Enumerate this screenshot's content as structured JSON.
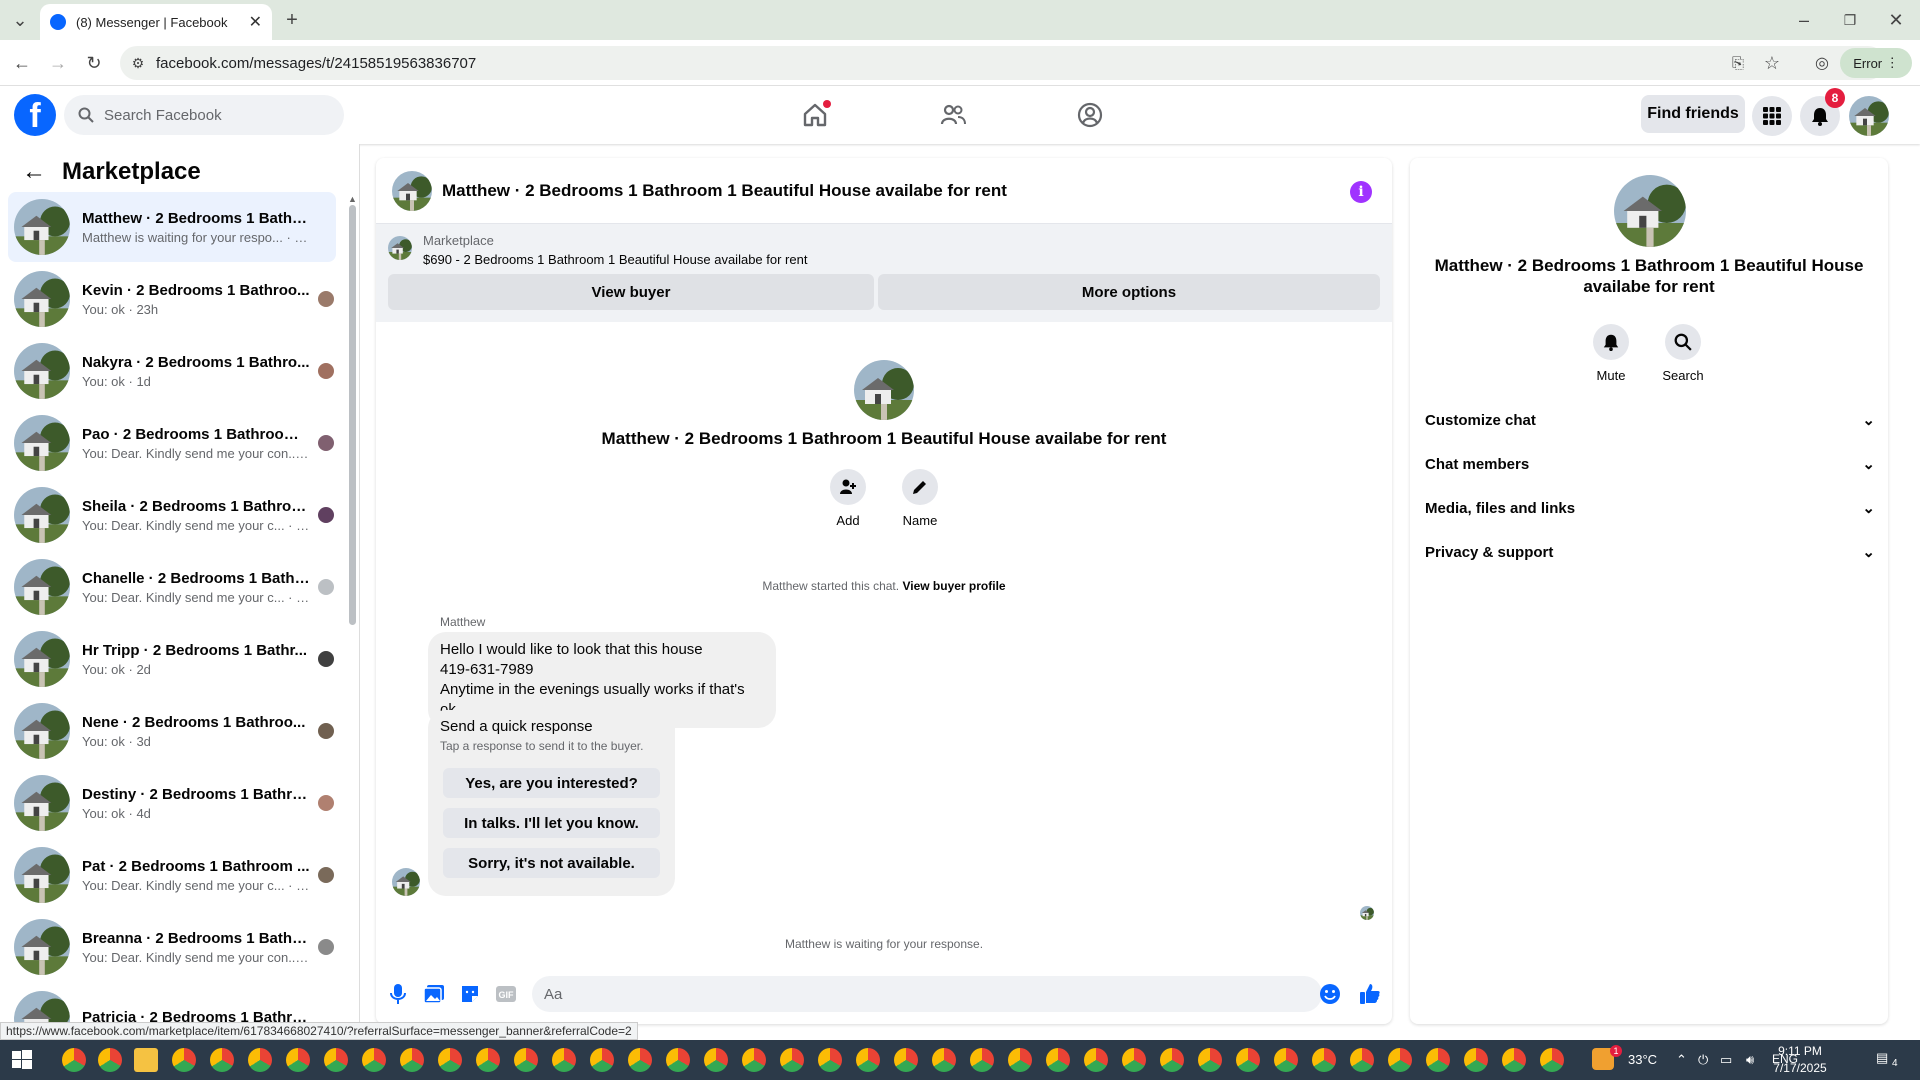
{
  "browser": {
    "tab_title": "(8) Messenger | Facebook",
    "url": "facebook.com/messages/t/24158519563836707",
    "profile_status": "Error",
    "status_link": "https://www.facebook.com/marketplace/item/617834668027410/?referralSurface=messenger_banner&referralCode=2"
  },
  "header": {
    "search_placeholder": "Search Facebook",
    "find_friends": "Find friends",
    "notification_count": "8"
  },
  "sidebar": {
    "title": "Marketplace",
    "conversations": [
      {
        "name": "Matthew · 2 Bedrooms 1 Bathro...",
        "snippet": "Matthew is waiting for your respo... · 13h",
        "active": true
      },
      {
        "name": "Kevin · 2 Bedrooms 1 Bathroo...",
        "snippet": "You: ok · 23h"
      },
      {
        "name": "Nakyra · 2 Bedrooms 1 Bathro...",
        "snippet": "You: ok · 1d"
      },
      {
        "name": "Pao · 2 Bedrooms 1 Bathroom 1 ...",
        "snippet": "You: Dear. Kindly send me your con... · 2d"
      },
      {
        "name": "Sheila · 2 Bedrooms 1 Bathroo...",
        "snippet": "You: Dear. Kindly send me your c... · 2d"
      },
      {
        "name": "Chanelle · 2 Bedrooms 1 Bathr...",
        "snippet": "You: Dear. Kindly send me your c... · 2d"
      },
      {
        "name": "Hr Tripp · 2 Bedrooms 1 Bathr...",
        "snippet": "You: ok · 2d"
      },
      {
        "name": "Nene · 2 Bedrooms 1 Bathroo...",
        "snippet": "You: ok · 3d"
      },
      {
        "name": "Destiny · 2 Bedrooms 1 Bathro...",
        "snippet": "You: ok · 4d"
      },
      {
        "name": "Pat · 2 Bedrooms 1 Bathroom ...",
        "snippet": "You: Dear. Kindly send me your c... · 4d"
      },
      {
        "name": "Breanna · 2 Bedrooms 1 Bathroo...",
        "snippet": "You: Dear. Kindly send me your con... · 4d"
      },
      {
        "name": "Patricia · 2 Bedrooms 1 Bathroo...",
        "snippet": ""
      }
    ]
  },
  "chat": {
    "title": "Matthew · 2 Bedrooms 1 Bathroom 1 Beautiful House availabe for rent",
    "banner_label": "Marketplace",
    "banner_desc": "$690 - 2 Bedrooms 1 Bathroom 1 Beautiful House availabe for rent",
    "view_buyer": "View buyer",
    "more_options": "More options",
    "add_label": "Add",
    "name_label": "Name",
    "started_text": "Matthew started this chat.",
    "view_buyer_profile": "View buyer profile",
    "sender": "Matthew",
    "message_lines": [
      "Hello I would like to look that this house",
      "419-631-7989",
      "Anytime in the evenings usually works if that's ok"
    ],
    "quick_title": "Send a quick response",
    "quick_sub": "Tap a response to send it to the buyer.",
    "quick_responses": [
      "Yes, are you interested?",
      "In talks. I'll let you know.",
      "Sorry, it's not available."
    ],
    "waiting": "Matthew is waiting for your response.",
    "composer_placeholder": "Aa"
  },
  "details": {
    "title": "Matthew · 2 Bedrooms 1 Bathroom 1 Beautiful House availabe for rent",
    "mute": "Mute",
    "search": "Search",
    "sections": [
      "Customize chat",
      "Chat members",
      "Media, files and links",
      "Privacy & support"
    ]
  },
  "taskbar": {
    "temperature": "33°C",
    "lang": "ENG",
    "time": "9:11 PM",
    "date": "7/17/2025",
    "weather_badge": "1",
    "action_center_count": "4"
  }
}
